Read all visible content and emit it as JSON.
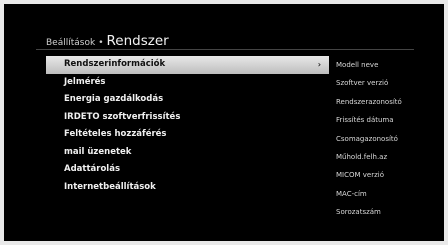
{
  "header": {
    "breadcrumb": "Beállítások",
    "separator": "•",
    "title": "Rendszer"
  },
  "menu": {
    "items": [
      {
        "label": "Rendszerinformációk",
        "selected": true
      },
      {
        "label": "Jelmérés"
      },
      {
        "label": "Energia gazdálkodás"
      },
      {
        "label": "IRDETO szoftverfrissítés"
      },
      {
        "label": "Feltételes hozzáférés"
      },
      {
        "label": "mail üzenetek"
      },
      {
        "label": "Adattárolás"
      },
      {
        "label": "Internetbeállítások"
      }
    ],
    "selected_arrow": "›"
  },
  "details": {
    "items": [
      "Modell neve",
      "Szoftver verzió",
      "Rendszerazonosító",
      "Frissítés dátuma",
      "Csomagazonosító",
      "Műhold.felh.az",
      "MICOM verzió",
      "MAC-cím",
      "Sorozatszám"
    ]
  }
}
